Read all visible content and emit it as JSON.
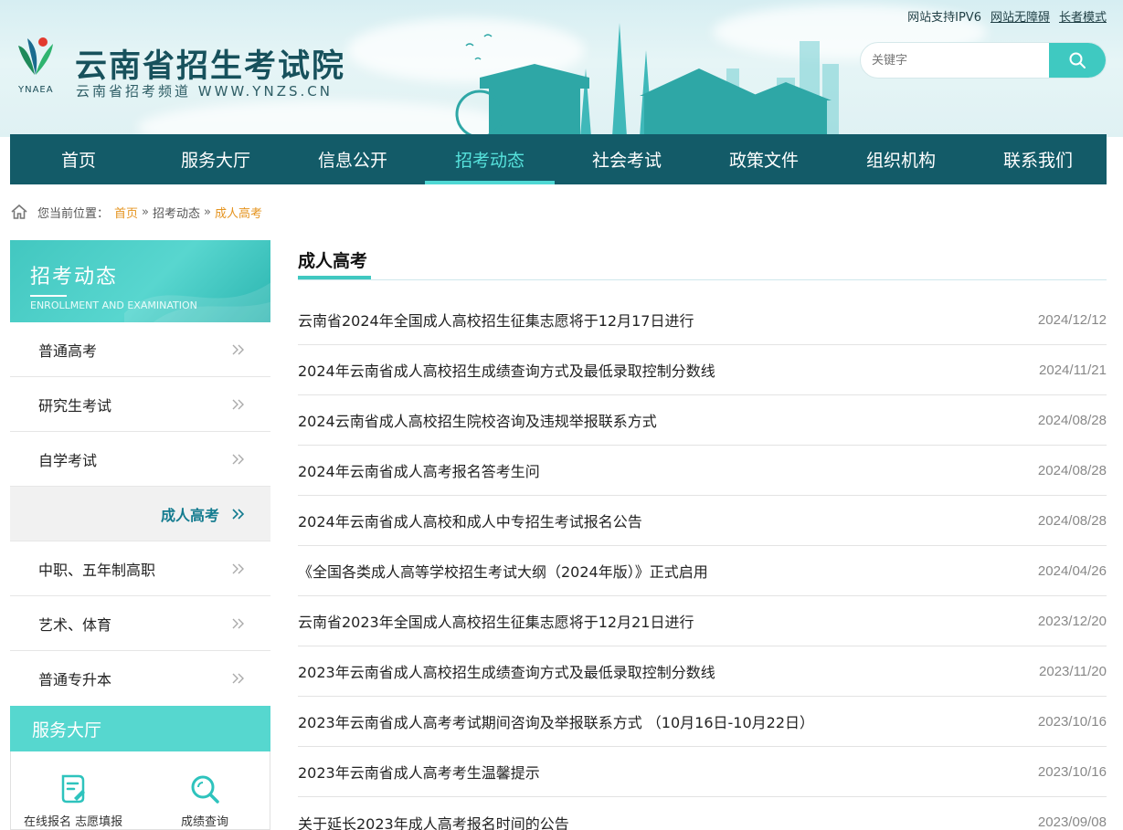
{
  "header": {
    "site_title": "云南省招生考试院",
    "site_subtitle": "云南省招考频道 WWW.YNZS.CN",
    "logo_text": "YNAEA",
    "top_links": [
      "网站支持IPV6",
      "网站无障碍",
      "长者模式"
    ],
    "search_placeholder": "关键字"
  },
  "nav": {
    "items": [
      "首页",
      "服务大厅",
      "信息公开",
      "招考动态",
      "社会考试",
      "政策文件",
      "组织机构",
      "联系我们"
    ],
    "active": "招考动态"
  },
  "breadcrumb": {
    "label": "您当前位置：",
    "items": [
      "首页",
      "招考动态",
      "成人高考"
    ]
  },
  "sidebar": {
    "title": "招考动态",
    "title_en": "ENROLLMENT AND EXAMINATION",
    "items": [
      "普通高考",
      "研究生考试",
      "自学考试",
      "成人高考",
      "中职、五年制高职",
      "艺术、体育",
      "普通专升本"
    ],
    "active": "成人高考",
    "service_title": "服务大厅",
    "services": [
      "在线报名 志愿填报",
      "成绩查询"
    ]
  },
  "main": {
    "title": "成人高考",
    "news": [
      {
        "title": "云南省2024年全国成人高校招生征集志愿将于12月17日进行",
        "date": "2024/12/12"
      },
      {
        "title": "2024年云南省成人高校招生成绩查询方式及最低录取控制分数线",
        "date": "2024/11/21"
      },
      {
        "title": "2024云南省成人高校招生院校咨询及违规举报联系方式",
        "date": "2024/08/28"
      },
      {
        "title": "2024年云南省成人高考报名答考生问",
        "date": "2024/08/28"
      },
      {
        "title": "2024年云南省成人高校和成人中专招生考试报名公告",
        "date": "2024/08/28"
      },
      {
        "title": "《全国各类成人高等学校招生考试大纲（2024年版）》正式启用",
        "date": "2024/04/26"
      },
      {
        "title": "云南省2023年全国成人高校招生征集志愿将于12月21日进行",
        "date": "2023/12/20"
      },
      {
        "title": "2023年云南省成人高校招生成绩查询方式及最低录取控制分数线",
        "date": "2023/11/20"
      },
      {
        "title": "2023年云南省成人高考考试期间咨询及举报联系方式 （10月16日-10月22日）",
        "date": "2023/10/16"
      },
      {
        "title": "2023年云南省成人高考考生温馨提示",
        "date": "2023/10/16"
      },
      {
        "title": "关于延长2023年成人高考报名时间的公告",
        "date": "2023/09/08"
      }
    ]
  },
  "colors": {
    "nav_bg": "#135b68",
    "accent": "#40c8c1",
    "active_text": "#56e2dc",
    "crumb_highlight": "#e59420"
  }
}
